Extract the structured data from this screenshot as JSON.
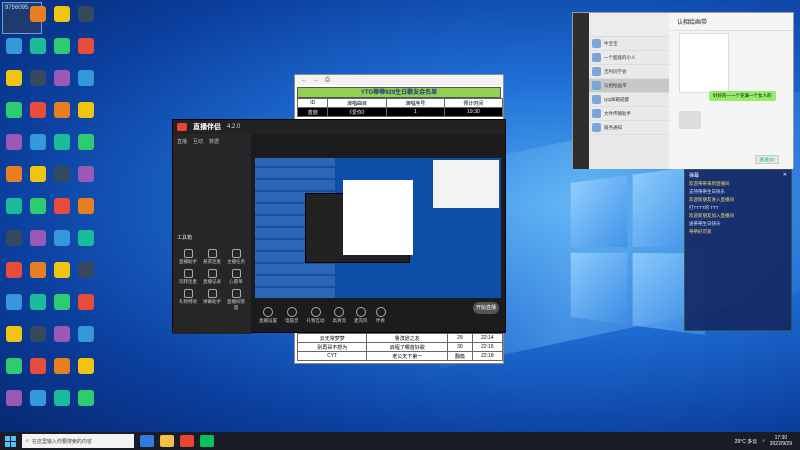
{
  "desktop": {
    "profile_id": "9756095",
    "icons": [
      "",
      "",
      "",
      "",
      "",
      "",
      "",
      "",
      "",
      "",
      "",
      "",
      "",
      "",
      "",
      "",
      "",
      "",
      "",
      ""
    ]
  },
  "document": {
    "title": "YTG蒂蒂929生日歌友会名单",
    "headers": [
      "ID",
      "演唱曲目",
      "演唱序号",
      "预计时间"
    ],
    "rows": [
      [
        "蓝菇",
        "《爱你》",
        "1",
        "19:30"
      ],
      [
        "云无常梦梦",
        "鲁滨逊之友",
        "29",
        "22:14"
      ],
      [
        "别再哥不想为",
        "启程了哪首好歌",
        "30",
        "22:16"
      ],
      [
        "CYT",
        "老公天下第一",
        "翻篇",
        "22:18"
      ]
    ]
  },
  "live": {
    "app_name": "直播伴侣",
    "version": "4.2.0",
    "tabs": [
      "直播",
      "互动",
      "数据"
    ],
    "tools_label": "工具箱",
    "tools": [
      "直播助手",
      "悬赏连麦",
      "主播任务",
      "玩转连麦",
      "直播记录",
      "心愿单",
      "礼物特效",
      "弹幕助手",
      "直播间管理"
    ],
    "controls": [
      "直播设置",
      "电脑音",
      "礼物互动",
      "高清流",
      "麦克风",
      "伴奏"
    ],
    "go_live": "开始直播"
  },
  "wechat": {
    "chat_title": "认相绘画带",
    "contacts": [
      "牛宝宝",
      "一个超能的小人",
      "吉利同学会",
      "认相绘画带",
      "QQ邮箱提醒",
      "文件传输助手",
      "服务通知",
      "订阅号"
    ],
    "bubble": "好好的—一个充满一个女人的",
    "send_label": "发送(S)"
  },
  "danmaku": {
    "title": "弹幕",
    "messages": [
      "欢迎蒂蒂来到直播间",
      "支持蒂蒂生日快乐",
      "欢迎新朋友进入直播间",
      "打TTTT的 TTT",
      "欢迎新朋友加入直播间",
      "送蒂蒂生日快乐",
      "蒂蒂好可爱"
    ]
  },
  "taskbar": {
    "search_placeholder": "在这里输入你要搜索的内容",
    "weather": "29°C 多云",
    "time": "17:30",
    "date": "2022/9/29"
  },
  "colors": {
    "taskbar": "#1a1d28",
    "doc_header": "#92d050",
    "live_accent": "#e8442f",
    "wechat_green": "#95ec69"
  }
}
